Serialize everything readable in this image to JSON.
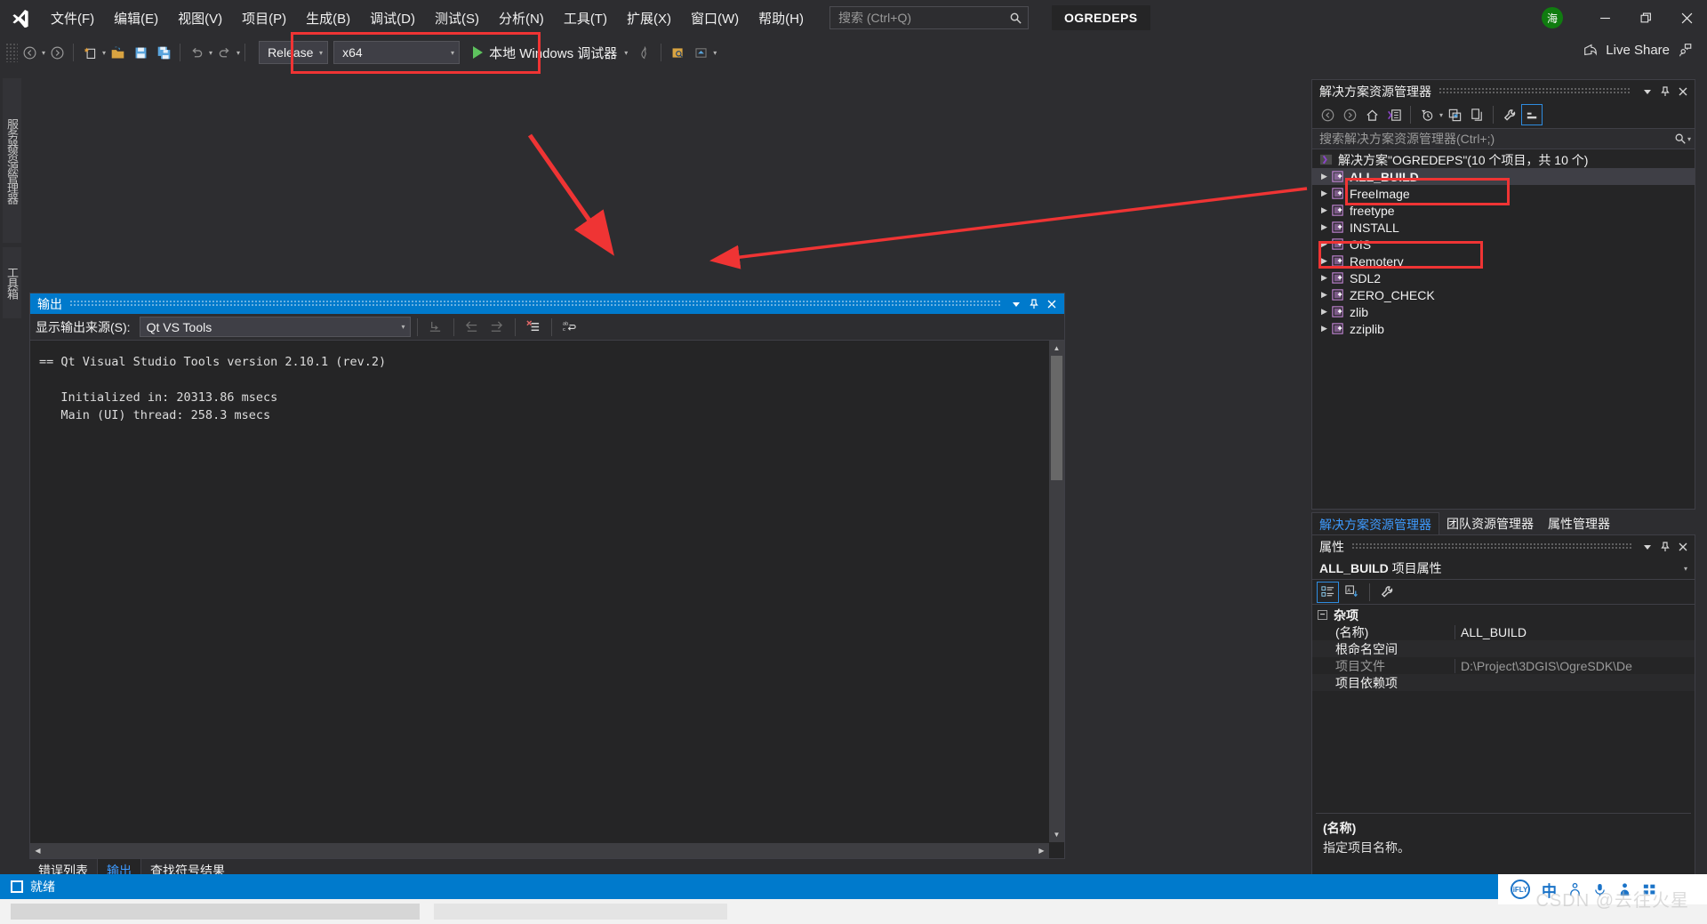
{
  "window": {
    "solution_badge": "OGREDEPS",
    "avatar_initial": "海",
    "live_share": "Live Share",
    "minimize": "minimize-icon",
    "restore": "restore-icon",
    "close": "close-icon"
  },
  "menu": {
    "items": [
      {
        "label": "文件(F)"
      },
      {
        "label": "编辑(E)"
      },
      {
        "label": "视图(V)"
      },
      {
        "label": "项目(P)"
      },
      {
        "label": "生成(B)"
      },
      {
        "label": "调试(D)"
      },
      {
        "label": "测试(S)"
      },
      {
        "label": "分析(N)"
      },
      {
        "label": "工具(T)"
      },
      {
        "label": "扩展(X)"
      },
      {
        "label": "窗口(W)"
      },
      {
        "label": "帮助(H)"
      }
    ]
  },
  "search": {
    "placeholder": "搜索 (Ctrl+Q)",
    "value": ""
  },
  "toolbar": {
    "configuration": "Release",
    "platform": "x64",
    "run_label": "本地 Windows 调试器",
    "icons": [
      "navigate-back-icon",
      "navigate-forward-icon",
      "new-project-icon",
      "open-file-icon",
      "save-icon",
      "save-all-icon",
      "undo-icon",
      "redo-icon",
      "hot-reload-icon",
      "attach-process-icon",
      "preview-icon"
    ]
  },
  "left_tabs": [
    {
      "label": "服务器资源管理器"
    },
    {
      "label": "工具箱"
    }
  ],
  "output_panel": {
    "title": "输出",
    "source_label": "显示输出来源(S):",
    "source_value": "Qt VS Tools",
    "toolbar_icons": [
      "go-to-message-icon",
      "previous-message-icon",
      "next-message-icon",
      "clear-all-icon",
      "toggle-word-wrap-icon"
    ],
    "lines": [
      "== Qt Visual Studio Tools version 2.10.1 (rev.2)",
      "",
      "   Initialized in: 20313.86 msecs",
      "   Main (UI) thread: 258.3 msecs"
    ]
  },
  "dock_tabs": [
    {
      "label": "错误列表",
      "active": false
    },
    {
      "label": "输出",
      "active": true
    },
    {
      "label": "查找符号结果",
      "active": false
    }
  ],
  "solution_explorer": {
    "title": "解决方案资源管理器",
    "search_placeholder": "搜索解决方案资源管理器(Ctrl+;)",
    "toolbar_icons": [
      "back-icon",
      "forward-icon",
      "home-icon",
      "switch-views-icon",
      "pending-changes-filter-icon",
      "sync-with-active-document-icon",
      "refresh-icon",
      "show-all-files-icon",
      "properties-icon",
      "collapse-all-icon"
    ],
    "root": "解决方案\"OGREDEPS\"(10 个项目，共 10 个)",
    "projects": [
      {
        "label": "ALL_BUILD",
        "selected": true,
        "highlighted": true
      },
      {
        "label": "FreeImage",
        "selected": false,
        "highlighted": false
      },
      {
        "label": "freetype",
        "selected": false,
        "highlighted": false
      },
      {
        "label": "INSTALL",
        "selected": false,
        "highlighted": true
      },
      {
        "label": "OIS",
        "selected": false,
        "highlighted": false
      },
      {
        "label": "Remotery",
        "selected": false,
        "highlighted": false
      },
      {
        "label": "SDL2",
        "selected": false,
        "highlighted": false
      },
      {
        "label": "ZERO_CHECK",
        "selected": false,
        "highlighted": false
      },
      {
        "label": "zlib",
        "selected": false,
        "highlighted": false
      },
      {
        "label": "zziplib",
        "selected": false,
        "highlighted": false
      }
    ]
  },
  "se_tabs": [
    {
      "label": "解决方案资源管理器",
      "active": true
    },
    {
      "label": "团队资源管理器",
      "active": false
    },
    {
      "label": "属性管理器",
      "active": false
    }
  ],
  "properties": {
    "title": "属性",
    "object_name": "ALL_BUILD",
    "object_suffix": "项目属性",
    "toolbar_icons": [
      "categorized-icon",
      "alphabetical-icon",
      "property-pages-icon"
    ],
    "group": "杂项",
    "rows": [
      {
        "key": "(名称)",
        "value": "ALL_BUILD",
        "dim_key": false,
        "dim_value": false
      },
      {
        "key": "根命名空间",
        "value": "",
        "dim_key": false,
        "dim_value": false
      },
      {
        "key": "项目文件",
        "value": "D:\\Project\\3DGIS\\OgreSDK\\De",
        "dim_key": true,
        "dim_value": true
      },
      {
        "key": "项目依赖项",
        "value": "",
        "dim_key": false,
        "dim_value": false
      }
    ],
    "desc_title": "(名称)",
    "desc_text": "指定项目名称。"
  },
  "status_bar": {
    "text": "就绪",
    "up_arrow": "notifications-icon"
  },
  "ime": {
    "brand": "iFLY",
    "mode": "中"
  },
  "watermark": "CSDN @去往火星",
  "colors": {
    "accent": "#007acc",
    "annotation": "#ef3434",
    "chrome": "#2d2d30",
    "panel": "#252526",
    "selection": "#3f3f46",
    "run_green": "#5ec25e",
    "link": "#3e9bff"
  },
  "annotations": {
    "boxes": [
      {
        "name": "config-platform-highlight"
      },
      {
        "name": "all-build-highlight"
      },
      {
        "name": "install-highlight"
      }
    ],
    "arrows": [
      {
        "name": "arrow-to-config"
      },
      {
        "name": "arrow-to-install"
      }
    ]
  }
}
